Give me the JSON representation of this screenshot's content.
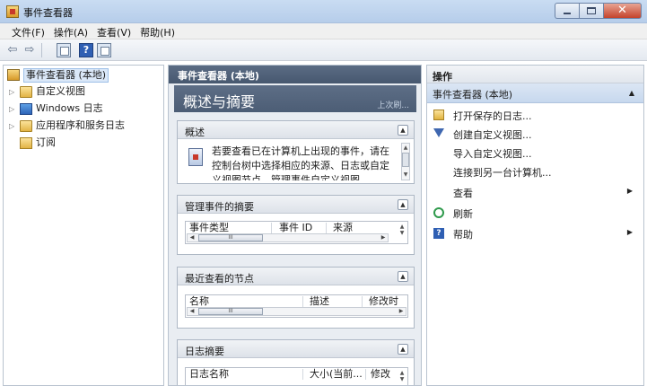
{
  "window": {
    "title": "事件查看器"
  },
  "menu": {
    "items": [
      "文件(F)",
      "操作(A)",
      "查看(V)",
      "帮助(H)"
    ]
  },
  "tree": {
    "items": [
      {
        "label": "事件查看器 (本地)",
        "icon": "event-viewer-icon",
        "expandable": false,
        "selected": true
      },
      {
        "label": "自定义视图",
        "icon": "folder-icon",
        "expandable": true
      },
      {
        "label": "Windows 日志",
        "icon": "windows-log-icon",
        "expandable": true
      },
      {
        "label": "应用程序和服务日志",
        "icon": "folder-icon",
        "expandable": true
      },
      {
        "label": "订阅",
        "icon": "subscription-icon",
        "expandable": false
      }
    ]
  },
  "center": {
    "header": "事件查看器 (本地)",
    "overview_title": "概述与摘要",
    "overview_link": "上次刷...",
    "sections": {
      "overview": {
        "title": "概述",
        "text": "若要查看已在计算机上出现的事件，请在控制台树中选择相应的来源、日志或自定义视图节点。管理事件自定义视图"
      },
      "admin_events": {
        "title": "管理事件的摘要",
        "columns": [
          "事件类型",
          "事件 ID",
          "来源"
        ]
      },
      "recent_nodes": {
        "title": "最近查看的节点",
        "columns": [
          "名称",
          "描述",
          "修改时"
        ]
      },
      "log_summary": {
        "title": "日志摘要",
        "columns": [
          "日志名称",
          "大小(当前...",
          "修改"
        ]
      }
    },
    "scroll_thumb_glyph": "III"
  },
  "actions": {
    "header": "操作",
    "group_title": "事件查看器 (本地)",
    "items": [
      {
        "label": "打开保存的日志...",
        "icon": "open-folder-icon",
        "submenu": false
      },
      {
        "label": "创建自定义视图...",
        "icon": "filter-icon",
        "submenu": false
      },
      {
        "label": "导入自定义视图...",
        "icon": "",
        "submenu": false
      },
      {
        "label": "连接到另一台计算机...",
        "icon": "",
        "submenu": false
      },
      {
        "label": "查看",
        "icon": "",
        "submenu": true
      },
      {
        "label": "刷新",
        "icon": "refresh-icon",
        "submenu": false
      },
      {
        "label": "帮助",
        "icon": "help-icon",
        "submenu": true
      }
    ]
  },
  "colors": {
    "title_bar": "#c9dcf2",
    "center_header": "#5a6c84",
    "actions_group": "#dbe6f4",
    "selection": "#dbe8f8"
  }
}
